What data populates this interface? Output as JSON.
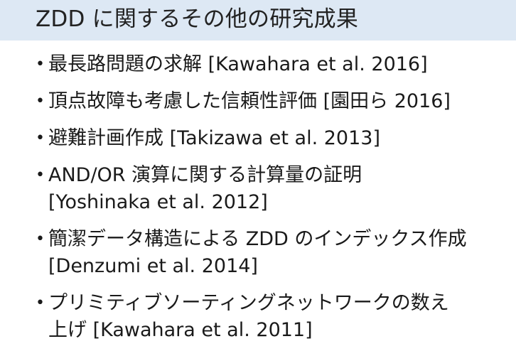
{
  "slide": {
    "title": "ZDD に関するその他の研究成果",
    "bullet_glyph": "•",
    "items": [
      {
        "lines": [
          "最長路問題の求解 [Kawahara et al. 2016]"
        ]
      },
      {
        "lines": [
          "頂点故障も考慮した信頼性評価 [園田ら 2016]"
        ]
      },
      {
        "lines": [
          "避難計画作成 [Takizawa et al. 2013]"
        ]
      },
      {
        "lines": [
          "AND/OR 演算に関する計算量の証明",
          "[Yoshinaka et al. 2012]"
        ]
      },
      {
        "lines": [
          "簡潔データ構造による ZDD のインデックス作成",
          "[Denzumi et al. 2014]"
        ]
      },
      {
        "lines": [
          "プリミティブソーティングネットワークの数え",
          "上げ [Kawahara et al. 2011]"
        ]
      }
    ]
  }
}
